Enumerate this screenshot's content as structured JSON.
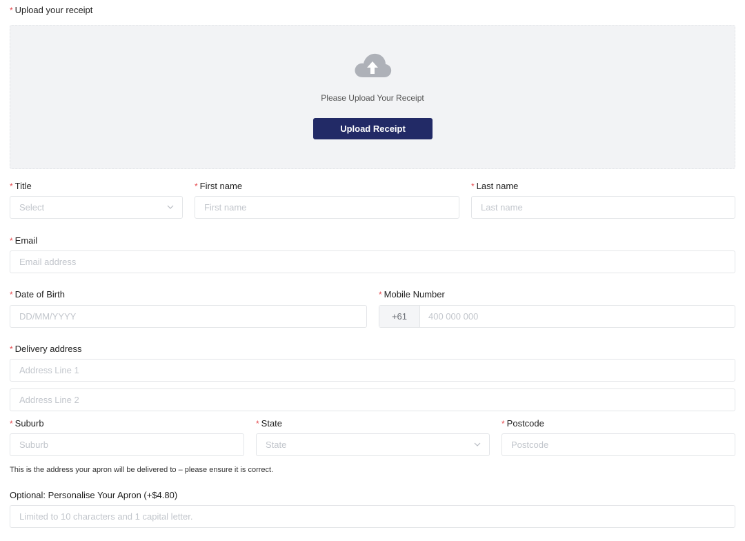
{
  "upload": {
    "label": "Upload your receipt",
    "prompt": "Please Upload Your Receipt",
    "button_label": "Upload Receipt",
    "icon": "cloud-upload-icon"
  },
  "title": {
    "label": "Title",
    "placeholder": "Select"
  },
  "first_name": {
    "label": "First name",
    "placeholder": "First name"
  },
  "last_name": {
    "label": "Last name",
    "placeholder": "Last name"
  },
  "email": {
    "label": "Email",
    "placeholder": "Email address"
  },
  "dob": {
    "label": "Date of Birth",
    "placeholder": "DD/MM/YYYY"
  },
  "mobile": {
    "label": "Mobile Number",
    "prefix": "+61",
    "placeholder": "400 000 000"
  },
  "delivery": {
    "label": "Delivery address",
    "line1_placeholder": "Address Line 1",
    "line2_placeholder": "Address Line 2"
  },
  "suburb": {
    "label": "Suburb",
    "placeholder": "Suburb"
  },
  "state": {
    "label": "State",
    "placeholder": "State"
  },
  "postcode": {
    "label": "Postcode",
    "placeholder": "Postcode"
  },
  "address_note": "This is the address your apron will be delivered to – please ensure it is correct.",
  "personalise": {
    "label": "Optional: Personalise Your Apron (+$4.80)",
    "placeholder": "Limited to 10 characters and 1 capital letter."
  },
  "required_mark": "*",
  "colors": {
    "accent": "#222a66",
    "required": "#e5484d",
    "upload_bg": "#f2f3f5"
  }
}
